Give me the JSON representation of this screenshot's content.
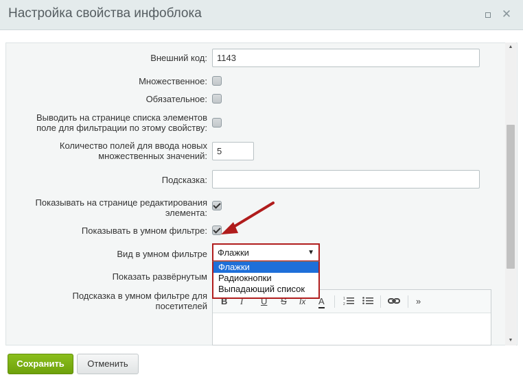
{
  "window": {
    "title": "Настройка свойства инфоблока"
  },
  "fields": {
    "external_code": {
      "label": "Внешний код:",
      "value": "1143"
    },
    "multiple": {
      "label": "Множественное:",
      "checked": false
    },
    "required": {
      "label": "Обязательное:",
      "checked": false
    },
    "list_filter": {
      "label_line1": "Выводить на странице списка элементов",
      "label_line2": "поле для фильтрации по этому свойству:",
      "checked": false
    },
    "multi_count": {
      "label_line1": "Количество полей для ввода новых",
      "label_line2": "множественных значений:",
      "value": "5"
    },
    "hint": {
      "label": "Подсказка:",
      "value": ""
    },
    "show_on_edit": {
      "label_line1": "Показывать на странице редактирования",
      "label_line2": "элемента:",
      "checked": true
    },
    "smart_filter": {
      "label": "Показывать в умном фильтре:",
      "checked": true
    },
    "smart_view": {
      "label": "Вид в умном фильтре",
      "selected": "Флажки",
      "options": [
        "Флажки",
        "Радиокнопки",
        "Выпадающий список"
      ]
    },
    "expanded": {
      "label": "Показать развёрнутым"
    },
    "filter_hint": {
      "label_line1": "Подсказка в умном фильтре для",
      "label_line2": "посетителей"
    }
  },
  "editor_toolbar": [
    "B",
    "I",
    "U",
    "S",
    "Ix",
    "A",
    "ordered-list-icon",
    "bullet-list-icon",
    "link-icon",
    "»"
  ],
  "footer": {
    "save_label": "Сохранить",
    "cancel_label": "Отменить"
  },
  "colors": {
    "accent_green": "#7cb312",
    "highlight_red": "#b01c1c",
    "selected_blue": "#1e6fd9"
  }
}
